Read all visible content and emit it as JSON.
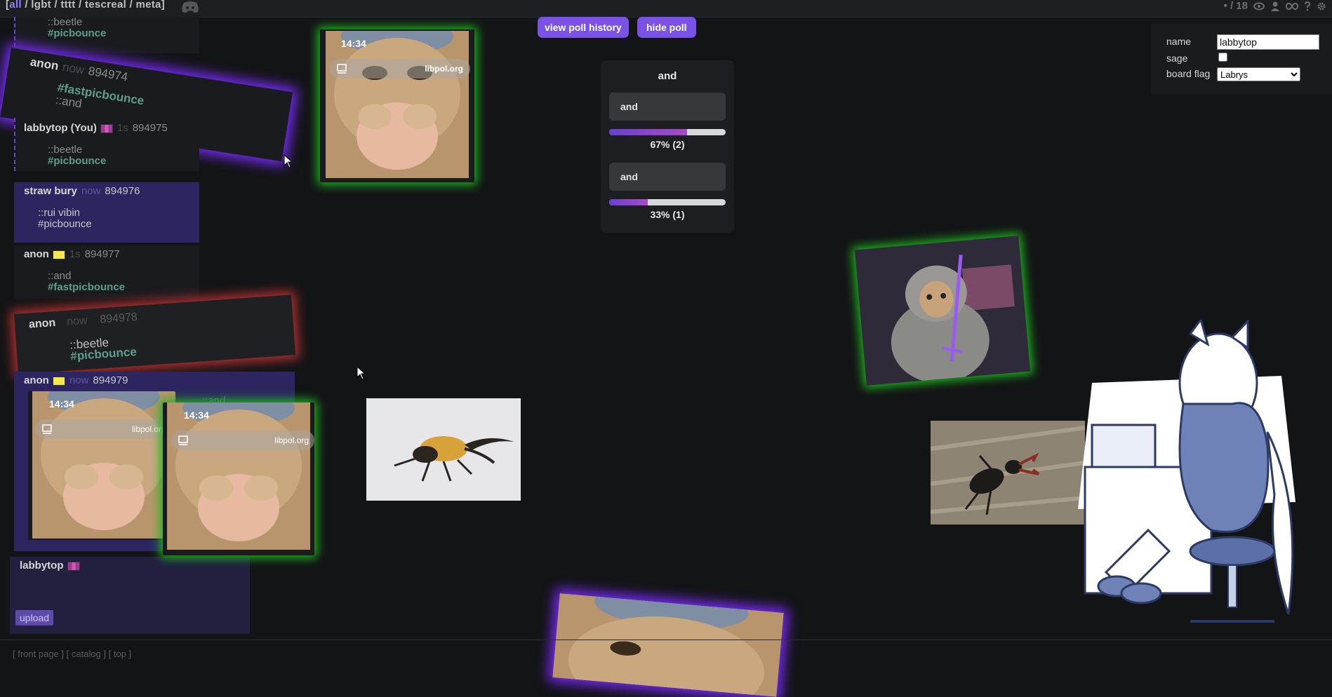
{
  "topbar": {
    "boards_open": "[",
    "board_current": "all",
    "boards_rest": " / lgbt / tttt / tescreal / meta]",
    "stats": "• / 18"
  },
  "posts": [
    {
      "body1": "::beetle",
      "tag": "#picbounce"
    },
    {
      "name": "anon",
      "time": "now",
      "num": "894974",
      "tag": "#fastpicbounce",
      "body": "::and"
    },
    {
      "name": "labbytop (You)",
      "time": "1s",
      "num": "894975",
      "body": "::beetle",
      "tag": "#picbounce"
    },
    {
      "name": "straw bury",
      "time": "now",
      "num": "894976",
      "body": "::rui vibin",
      "tag": "#picbounce"
    },
    {
      "name": "anon",
      "time": "1s",
      "num": "894977",
      "body": "::and",
      "tag": "#fastpicbounce"
    },
    {
      "name": "anon",
      "time": "now",
      "num": "894978",
      "body": "::beetle",
      "tag": "#picbounce"
    },
    {
      "name": "anon",
      "time": "now",
      "num": "894979",
      "body": "::and"
    },
    {
      "name": "labbytop",
      "upload": "upload"
    }
  ],
  "images": {
    "time": "14:34",
    "site": "libpol.org"
  },
  "poll": {
    "history_button": "view poll history",
    "hide_button": "hide poll",
    "title": "and",
    "options": [
      {
        "label": "and",
        "fraction": 0.67,
        "result": "67% (2)"
      },
      {
        "label": "and",
        "fraction": 0.33,
        "result": "33% (1)"
      }
    ]
  },
  "form": {
    "name_label": "name",
    "name_value": "labbytop",
    "sage_label": "sage",
    "flag_label": "board flag",
    "flag_value": "Labrys"
  },
  "footer": {
    "links": [
      "front page",
      "catalog",
      "top"
    ]
  },
  "colors": {
    "accent": "#7b52e6",
    "tag": "#5e9d8f",
    "own_post": "#2c2560",
    "glow_green": "#1fb41f",
    "glow_purple": "#7a2cff",
    "glow_red": "#b83232"
  }
}
